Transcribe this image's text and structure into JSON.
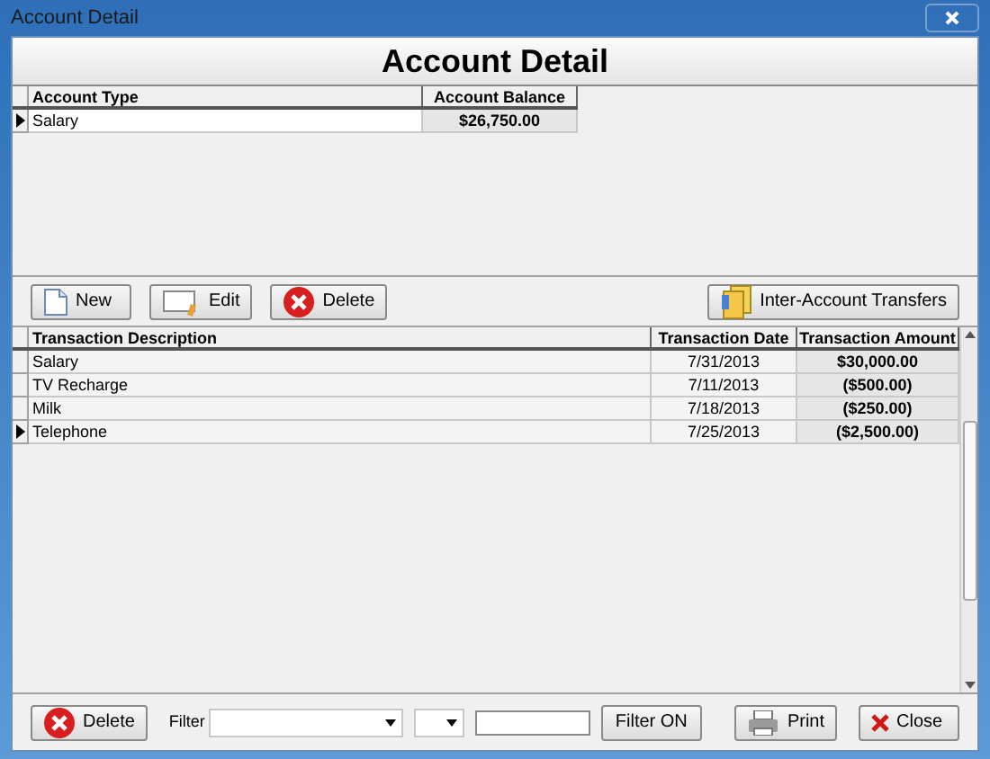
{
  "window": {
    "title": "Account Detail"
  },
  "header": {
    "title": "Account Detail"
  },
  "accounts": {
    "columns": [
      "Account Type",
      "Account Balance"
    ],
    "rows": [
      {
        "type": "Salary",
        "balance": "$26,750.00",
        "selected": true
      }
    ]
  },
  "toolbar": [
    {
      "kind": "new",
      "label": "New"
    },
    {
      "kind": "edit",
      "label": "Edit"
    },
    {
      "kind": "delete",
      "label": "Delete"
    },
    {
      "kind": "transfer",
      "label": "Inter-Account Transfers"
    }
  ],
  "transactions": {
    "columns": [
      "Transaction Description",
      "Transaction Date",
      "Transaction Amount"
    ],
    "rows": [
      {
        "description": "Salary",
        "date": "7/31/2013",
        "amount": "$30,000.00",
        "selected": false
      },
      {
        "description": "TV Recharge",
        "date": "7/11/2013",
        "amount": "($500.00)",
        "selected": false
      },
      {
        "description": "Milk",
        "date": "7/18/2013",
        "amount": "($250.00)",
        "selected": false
      },
      {
        "description": "Telephone",
        "date": "7/25/2013",
        "amount": "($2,500.00)",
        "selected": true
      }
    ]
  },
  "footer": {
    "delete": "Delete",
    "filter_label": "Filter",
    "filter_on": "Filter ON",
    "print": "Print",
    "close": "Close"
  }
}
